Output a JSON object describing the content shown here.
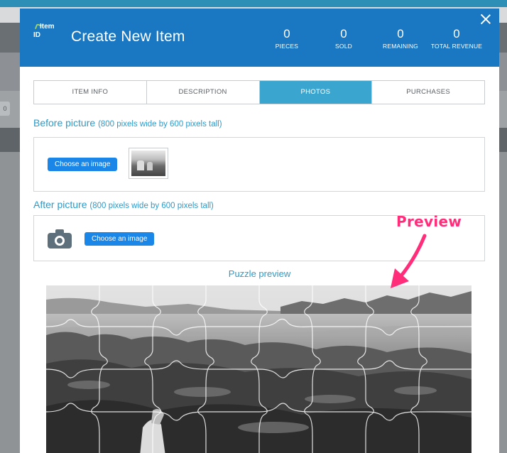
{
  "modal": {
    "logo_line1": "Item",
    "logo_line2": "ID",
    "title": "Create New Item",
    "stats": [
      {
        "value": "0",
        "label": "PIECES"
      },
      {
        "value": "0",
        "label": "SOLD"
      },
      {
        "value": "0",
        "label": "REMAINING"
      },
      {
        "value": "0",
        "label": "TOTAL REVENUE"
      }
    ]
  },
  "tabs": [
    {
      "label": "ITEM INFO",
      "active": false
    },
    {
      "label": "DESCRIPTION",
      "active": false
    },
    {
      "label": "PHOTOS",
      "active": true
    },
    {
      "label": "PURCHASES",
      "active": false
    }
  ],
  "before": {
    "title": "Before picture",
    "hint": "(800 pixels wide by 600 pixels tall)",
    "button": "Choose an image"
  },
  "after": {
    "title": "After picture",
    "hint": "(800 pixels wide by 600 pixels tall)",
    "button": "Choose an image"
  },
  "puzzle": {
    "title": "Puzzle preview"
  },
  "annotation": {
    "text": "Preview",
    "color": "#ff2d7a"
  },
  "background": {
    "chip_text": "0"
  },
  "colors": {
    "header": "#1a78c2",
    "active_tab": "#3aa6cf",
    "accent_text": "#2c9bc9",
    "button": "#1a86e8"
  }
}
